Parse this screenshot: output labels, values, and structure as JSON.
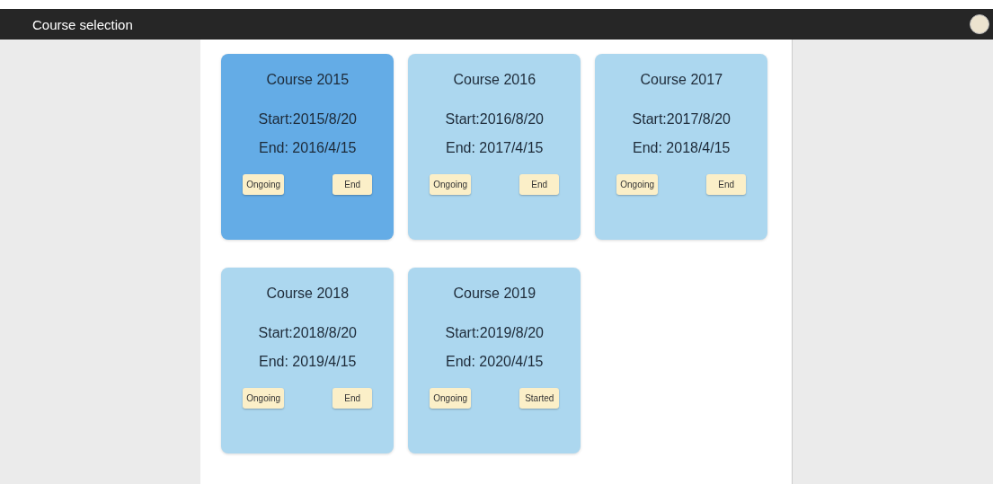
{
  "window": {
    "title": "Course selection"
  },
  "courses": [
    {
      "title": "Course 2015",
      "start": "Start:2015/8/20",
      "end": "End: 2016/4/15",
      "buttons": [
        "Ongoing",
        "End"
      ],
      "selected": true
    },
    {
      "title": "Course 2016",
      "start": "Start:2016/8/20",
      "end": "End: 2017/4/15",
      "buttons": [
        "Ongoing",
        "End"
      ],
      "selected": false
    },
    {
      "title": "Course 2017",
      "start": "Start:2017/8/20",
      "end": "End: 2018/4/15",
      "buttons": [
        "Ongoing",
        "End"
      ],
      "selected": false
    },
    {
      "title": "Course 2018",
      "start": "Start:2018/8/20",
      "end": "End: 2019/4/15",
      "buttons": [
        "Ongoing",
        "End"
      ],
      "selected": false
    },
    {
      "title": "Course 2019",
      "start": "Start:2019/8/20",
      "end": "End: 2020/4/15",
      "buttons": [
        "Ongoing",
        "Started"
      ],
      "selected": false
    }
  ]
}
